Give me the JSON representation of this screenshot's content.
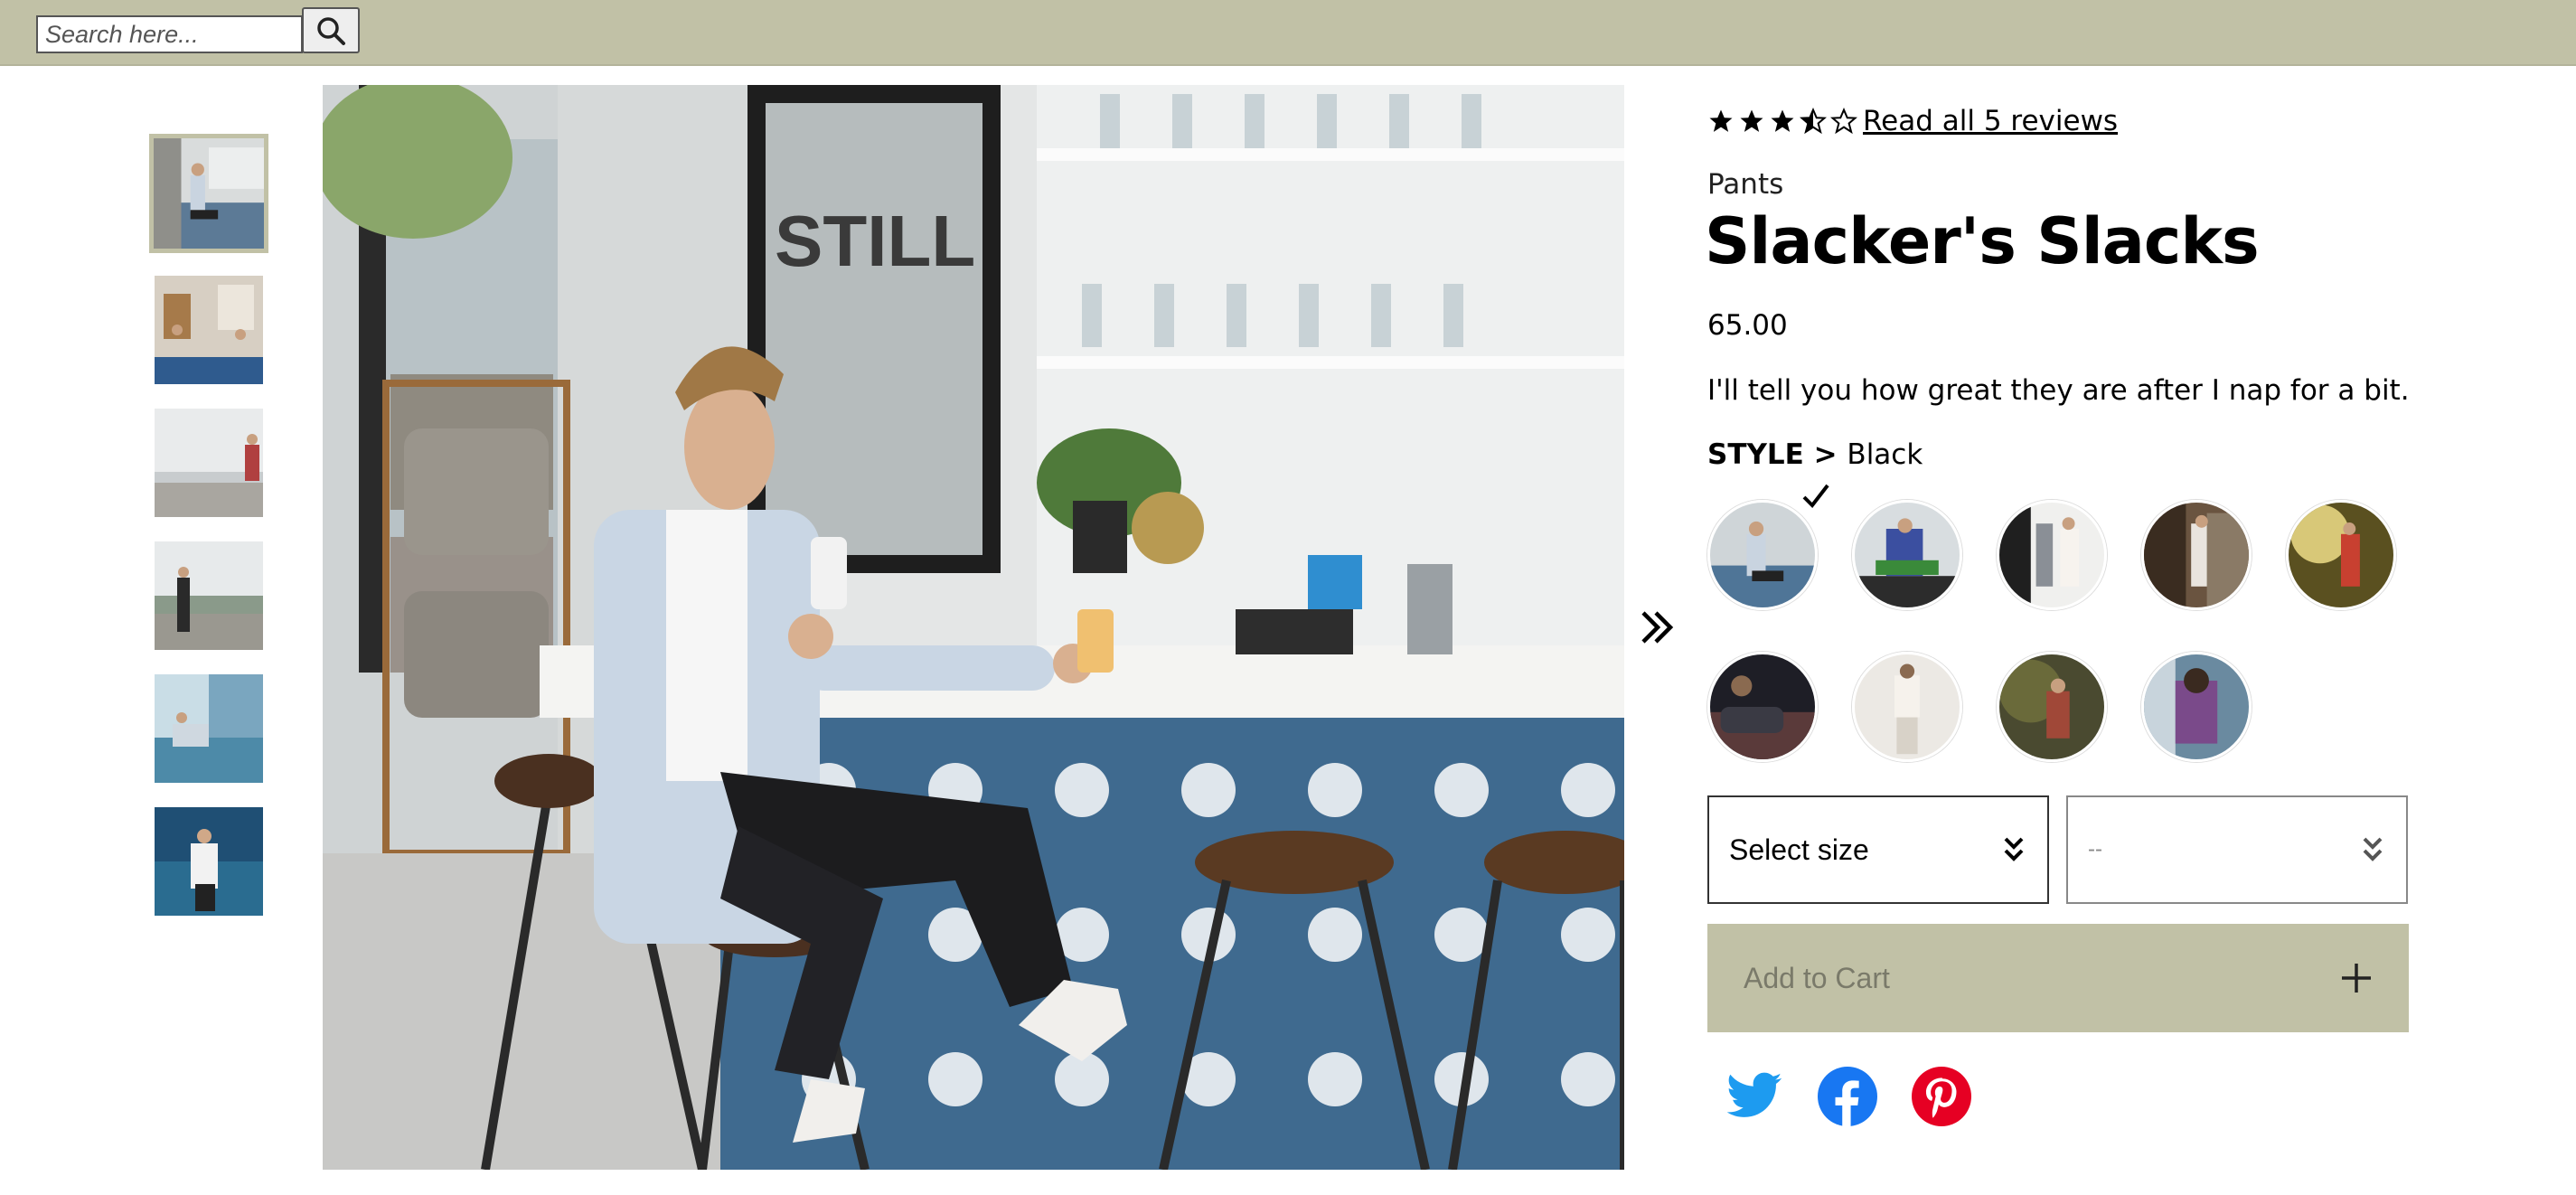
{
  "search": {
    "placeholder": "Search here...",
    "button_icon": "search-icon"
  },
  "thumbnails": [
    {
      "label": "thumbnail 1",
      "selected": true
    },
    {
      "label": "thumbnail 2",
      "selected": false
    },
    {
      "label": "thumbnail 3",
      "selected": false
    },
    {
      "label": "thumbnail 4",
      "selected": false
    },
    {
      "label": "thumbnail 5",
      "selected": false
    },
    {
      "label": "thumbnail 6",
      "selected": false
    }
  ],
  "main_image": {
    "next_icon": "double-chevron-right-icon"
  },
  "product": {
    "rating": {
      "value": 3,
      "max": 5,
      "reviews_link": "Read all 5 reviews"
    },
    "category": "Pants",
    "title": "Slacker's Slacks",
    "price": "65.00",
    "description": "I'll tell you how great they are after I nap for a bit.",
    "style_label": "STYLE",
    "style_separator": " > ",
    "style_value": "Black"
  },
  "styles": [
    {
      "name": "style 1",
      "selected": true
    },
    {
      "name": "style 2",
      "selected": false
    },
    {
      "name": "style 3",
      "selected": false
    },
    {
      "name": "style 4",
      "selected": false
    },
    {
      "name": "style 5",
      "selected": false
    },
    {
      "name": "style 6",
      "selected": false
    },
    {
      "name": "style 7",
      "selected": false
    },
    {
      "name": "style 8",
      "selected": false
    },
    {
      "name": "style 9",
      "selected": false
    }
  ],
  "size_select": {
    "value": "Select size"
  },
  "quantity_select": {
    "value": "--"
  },
  "cart": {
    "label": "Add to Cart"
  },
  "share": [
    {
      "network": "Twitter",
      "color": "#1d9bf0",
      "icon": "twitter-icon"
    },
    {
      "network": "Facebook",
      "color": "#1877f2",
      "icon": "facebook-icon"
    },
    {
      "network": "Pinterest",
      "color": "#e60023",
      "icon": "pinterest-icon"
    }
  ],
  "colors": {
    "accent": "#c1c1a6",
    "text": "#000000"
  }
}
